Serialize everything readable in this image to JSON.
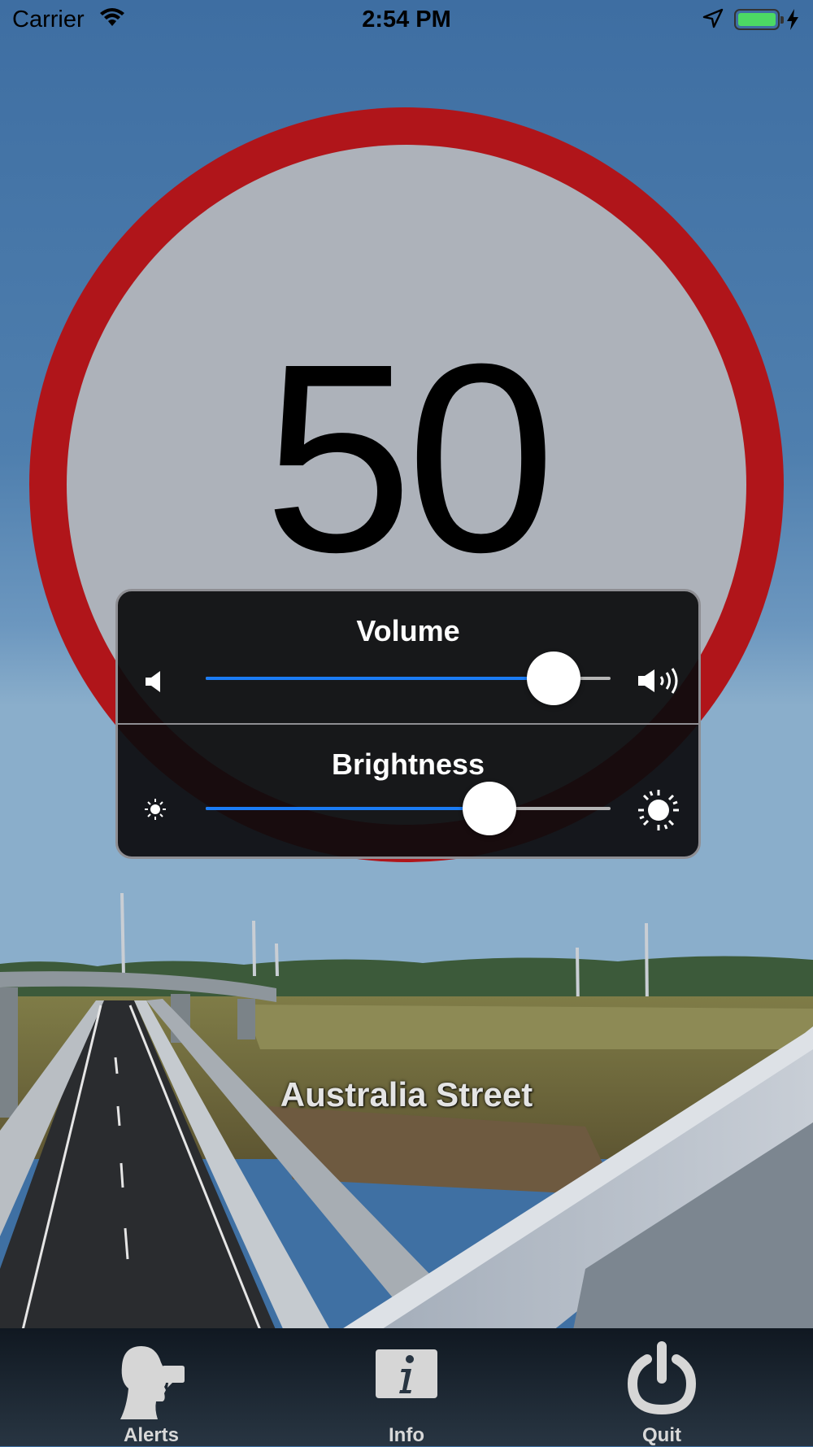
{
  "status_bar": {
    "carrier": "Carrier",
    "time": "2:54 PM",
    "battery_level": 1.0,
    "icons": [
      "wifi-icon",
      "location-arrow-icon",
      "battery-icon",
      "charging-bolt-icon"
    ]
  },
  "sign": {
    "speed_limit": "50",
    "ring_color": "#b0151a",
    "face_color": "#adb2ba"
  },
  "controls": {
    "volume": {
      "label": "Volume",
      "value": 0.86,
      "min_icon": "speaker-low-icon",
      "max_icon": "speaker-high-icon"
    },
    "brightness": {
      "label": "Brightness",
      "value": 0.7,
      "min_icon": "sun-small-icon",
      "max_icon": "sun-large-icon"
    },
    "accent_color": "#1b7cf5"
  },
  "street_name": "Australia Street",
  "tabbar": {
    "tabs": [
      {
        "label": "Alerts",
        "icon": "speaking-head-icon"
      },
      {
        "label": "Info",
        "icon": "info-icon"
      },
      {
        "label": "Quit",
        "icon": "power-icon"
      }
    ]
  }
}
